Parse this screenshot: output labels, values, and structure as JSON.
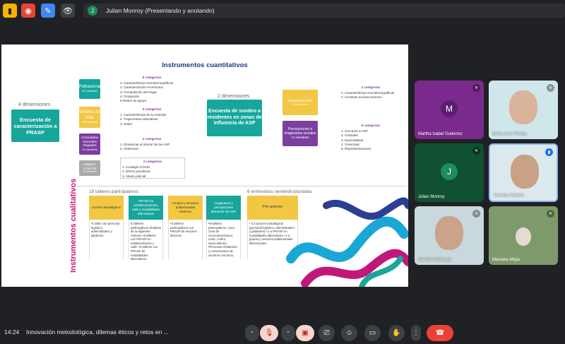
{
  "topbar": {
    "presenter_avatar": "J",
    "presenter_text": "Julian Monroy (Presentando y anotando)"
  },
  "slide": {
    "title": "Instrumentos cuantitativos",
    "left_dim": "4 dimensiones",
    "encuesta_caracterizacion": "Encuesta de caracterización a PRASP",
    "right_dim": "2 dimensiones",
    "encuesta_sondeo": "Encuesta de sondeo a residentes en zonas de influencia de ASP",
    "boxes": {
      "poblacional": "Poblacional",
      "poblacional_vars": "20 variables",
      "entorno": "Entorno de vida",
      "entorno_vars": "13 variables",
      "actividades": "Actividades Sexuales Pagadas",
      "actividades_vars": "14 variables",
      "impacto": "Impacto Covid-19",
      "impacto_vars": "5 variables",
      "caracterizacion": "Caracterización",
      "caracterizacion_vars": "13 variables",
      "percepciones": "Percepciones e imaginarios sociales",
      "percepciones_vars": "13 Variables"
    },
    "lists": {
      "l1_head": "5 categorías",
      "l1": [
        "1. Características sociodemográficas",
        "2. Caracterización económica",
        "3. Composición del hogar",
        "4. Ocupación",
        "5 Redes de apoyo"
      ],
      "l2_head": "3 categorías",
      "l2": [
        "1. Características de la vivienda",
        "2. Trayectorias educativas",
        "3. Salud"
      ],
      "l3_head": "2 categorías",
      "l3": [
        "1. Dinámicas al interior de las ASP",
        "2. Violencias"
      ],
      "l4_head": "3 categorías",
      "l4": [
        "1. Contagio COVID",
        "2. Efecto pandemia",
        "3. Abuso policial"
      ],
      "r1_head": "2 categorías",
      "r1": [
        "1. Características sociodemográficas",
        "2. Contexto socioeconómico"
      ],
      "r2_head": "5 categorías",
      "r2": [
        "1. Cercanía a ASP",
        "2. Actitudes",
        "3. Expectativas",
        "4. Creencias",
        "5. Representaciones"
      ]
    },
    "vertical_label": "Instrumentos cualitativos",
    "talleres_label": "18 talleres participativos",
    "entrevistas_label": "6 entrevistas semiestructuradas",
    "columns": [
      {
        "head": "Actores estratégicos",
        "body": "•1 taller con personal logístico, administrativo y jaladores"
      },
      {
        "head": "PRASP en establecimientos, calle y modalidades alternativas",
        "body": "6 Talleres participativos divididos de la siguiente manera: •3 talleres con PRASP en establecimiento y calle. •3 talleres con PRASP de modalidades alternativas."
      },
      {
        "head": "Grupos y sectores poblacionales diversos",
        "body": "•3 talleres participativos con PRASP de sectores diversos"
      },
      {
        "head": "Imaginarios y percepciones alrededor de ASP",
        "body": "•8 talleres participativos: 2 por zona de concentración(sur, norte, centro, suroccidente) •Personas residentes y comerciantes de sectores cercanos."
      },
      {
        "head": "Por actores",
        "body": "• 2 a actores estratégicos (personal logístico, administrativo y jaladores) • 2 a PRASP en modalidades alternativas • 2 a grupos y sectores poblacionales diferenciales"
      }
    ]
  },
  "participants": [
    {
      "name": "Martha Isabel Gutierrez",
      "initial": "M"
    },
    {
      "name": "Maria Jose Pareja",
      "initial": ""
    },
    {
      "name": "Julian Monroy",
      "initial": "J"
    },
    {
      "name": "Carolina Suarez",
      "initial": ""
    },
    {
      "name": "Carolina Montoya",
      "initial": ""
    },
    {
      "name": "Manuela Mejia",
      "initial": ""
    }
  ],
  "bottombar": {
    "time": "14:24",
    "meeting_title": "Innovación metodológica, dilemas éticos y retos en ..."
  },
  "colors": {
    "accent_red": "#ea4335",
    "teal": "#17a69b",
    "purple": "#7b3fa0",
    "yellow": "#f2c744",
    "magenta": "#c2177a"
  }
}
